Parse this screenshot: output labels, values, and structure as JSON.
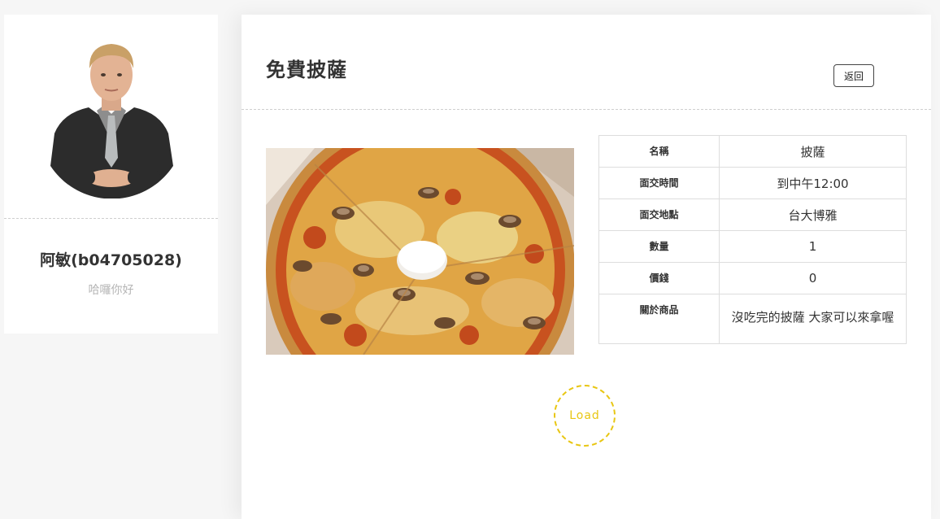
{
  "profile": {
    "name": "阿敏(b04705028)",
    "greeting": "哈囉你好"
  },
  "item": {
    "title": "免費披薩",
    "back_label": "返回",
    "details": [
      {
        "label": "名稱",
        "value": "披薩"
      },
      {
        "label": "面交時間",
        "value": "到中午12:00"
      },
      {
        "label": "面交地點",
        "value": "台大博雅"
      },
      {
        "label": "數量",
        "value": "1"
      },
      {
        "label": "價錢",
        "value": "0"
      },
      {
        "label": "關於商品",
        "value": "沒吃完的披薩 大家可以來拿喔"
      }
    ],
    "load_label": "Load"
  },
  "colors": {
    "accent": "#e8c612",
    "background": "#f6f6f6",
    "card": "#ffffff",
    "text": "#333333",
    "muted": "#b5b5b5"
  }
}
